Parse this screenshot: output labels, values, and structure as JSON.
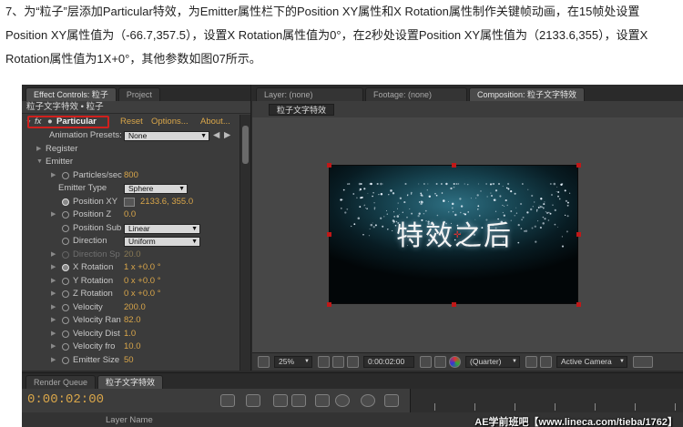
{
  "article": {
    "paragraph": "7、为“粒子”层添加Particular特效，为Emitter属性栏下的Position XY属性和X Rotation属性制作关键帧动画，在15帧处设置Position XY属性值为（-66.7,357.5），设置X Rotation属性值为0°，在2秒处设置Position XY属性值为（2133.6,355），设置X Rotation属性值为1X+0°，其他参数如图07所示。"
  },
  "effect_controls": {
    "tab_label": "Effect Controls: 粒子",
    "project_tab": "Project",
    "subtitle": "粒子文字特效 • 粒子",
    "effect_name": "Particular",
    "fx_label": "fx",
    "reset": "Reset",
    "options": "Options...",
    "about": "About...",
    "animation_presets_label": "Animation Presets:",
    "animation_presets_value": "None",
    "register": "Register",
    "emitter": "Emitter",
    "rows": [
      {
        "label": "Particles/sec",
        "value": "800"
      },
      {
        "label": "Emitter Type",
        "value": "Sphere"
      },
      {
        "label": "Position XY",
        "value": "2133.6, 355.0"
      },
      {
        "label": "Position Z",
        "value": "0.0"
      },
      {
        "label": "Position Sub",
        "value": "Linear"
      },
      {
        "label": "Direction",
        "value": "Uniform"
      },
      {
        "label": "Direction Sp",
        "value": "20.0"
      },
      {
        "label": "X Rotation",
        "value": "1 x +0.0 °"
      },
      {
        "label": "Y Rotation",
        "value": "0 x +0.0 °"
      },
      {
        "label": "Z Rotation",
        "value": "0 x +0.0 °"
      },
      {
        "label": "Velocity",
        "value": "200.0"
      },
      {
        "label": "Velocity Ran",
        "value": "82.0"
      },
      {
        "label": "Velocity Dist",
        "value": "1.0"
      },
      {
        "label": "Velocity fro",
        "value": "10.0"
      },
      {
        "label": "Emitter Size",
        "value": "50"
      }
    ]
  },
  "composition": {
    "layer_tab": "Layer: (none)",
    "footage_tab": "Footage: (none)",
    "comp_tab": "Composition: 粒子文字特效",
    "comp_chip": "粒子文字特效",
    "frame_text": "特效之后",
    "zoom": "25%",
    "timecode": "0:00:02:00",
    "resolution": "(Quarter)",
    "camera": "Active Camera"
  },
  "timeline": {
    "render_queue_tab": "Render Queue",
    "comp_tab": "粒子文字特效",
    "timecode": "0:00:02:00",
    "layer_name_header": "Layer Name",
    "watermark": "AE学前班吧【www.lineca.com/tieba/1762】"
  },
  "colors": {
    "accent_value": "#d9a64a",
    "highlight_box": "#d0201d",
    "panel_bg": "#3b3b3b"
  }
}
